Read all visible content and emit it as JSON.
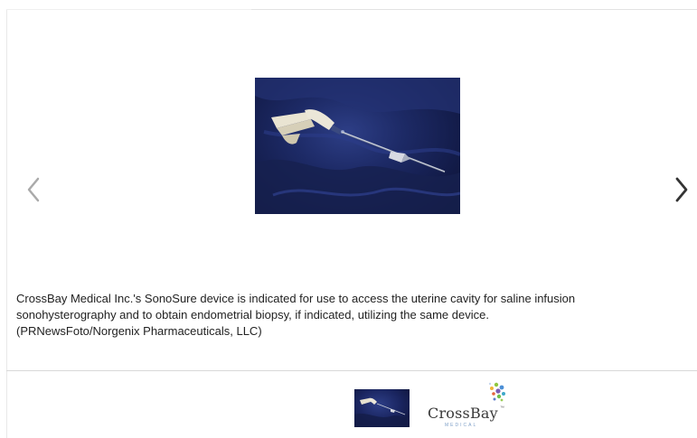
{
  "gallery": {
    "main_image": {
      "icon": "medical-device-photo",
      "background_color": "#1d2a66"
    },
    "prev_icon": "chevron-left-icon",
    "next_icon": "chevron-right-icon",
    "caption": "CrossBay Medical Inc.'s SonoSure device is indicated for use to access the uterine cavity for saline infusion\nsonohysterography and to obtain endometrial biopsy, if indicated, utilizing the same device.\n(PRNewsFoto/Norgenix Pharmaceuticals, LLC)",
    "thumbnails": [
      {
        "icon": "device-thumbnail"
      }
    ],
    "logo": {
      "icon": "crossbay-logo",
      "word": "CrossBay",
      "tm": "™",
      "sub": "MEDICAL"
    },
    "colors": {
      "arrow_prev": "#aaaaaa",
      "arrow_next": "#333333",
      "caption_text": "#222222",
      "divider": "#d8d8d8"
    }
  }
}
